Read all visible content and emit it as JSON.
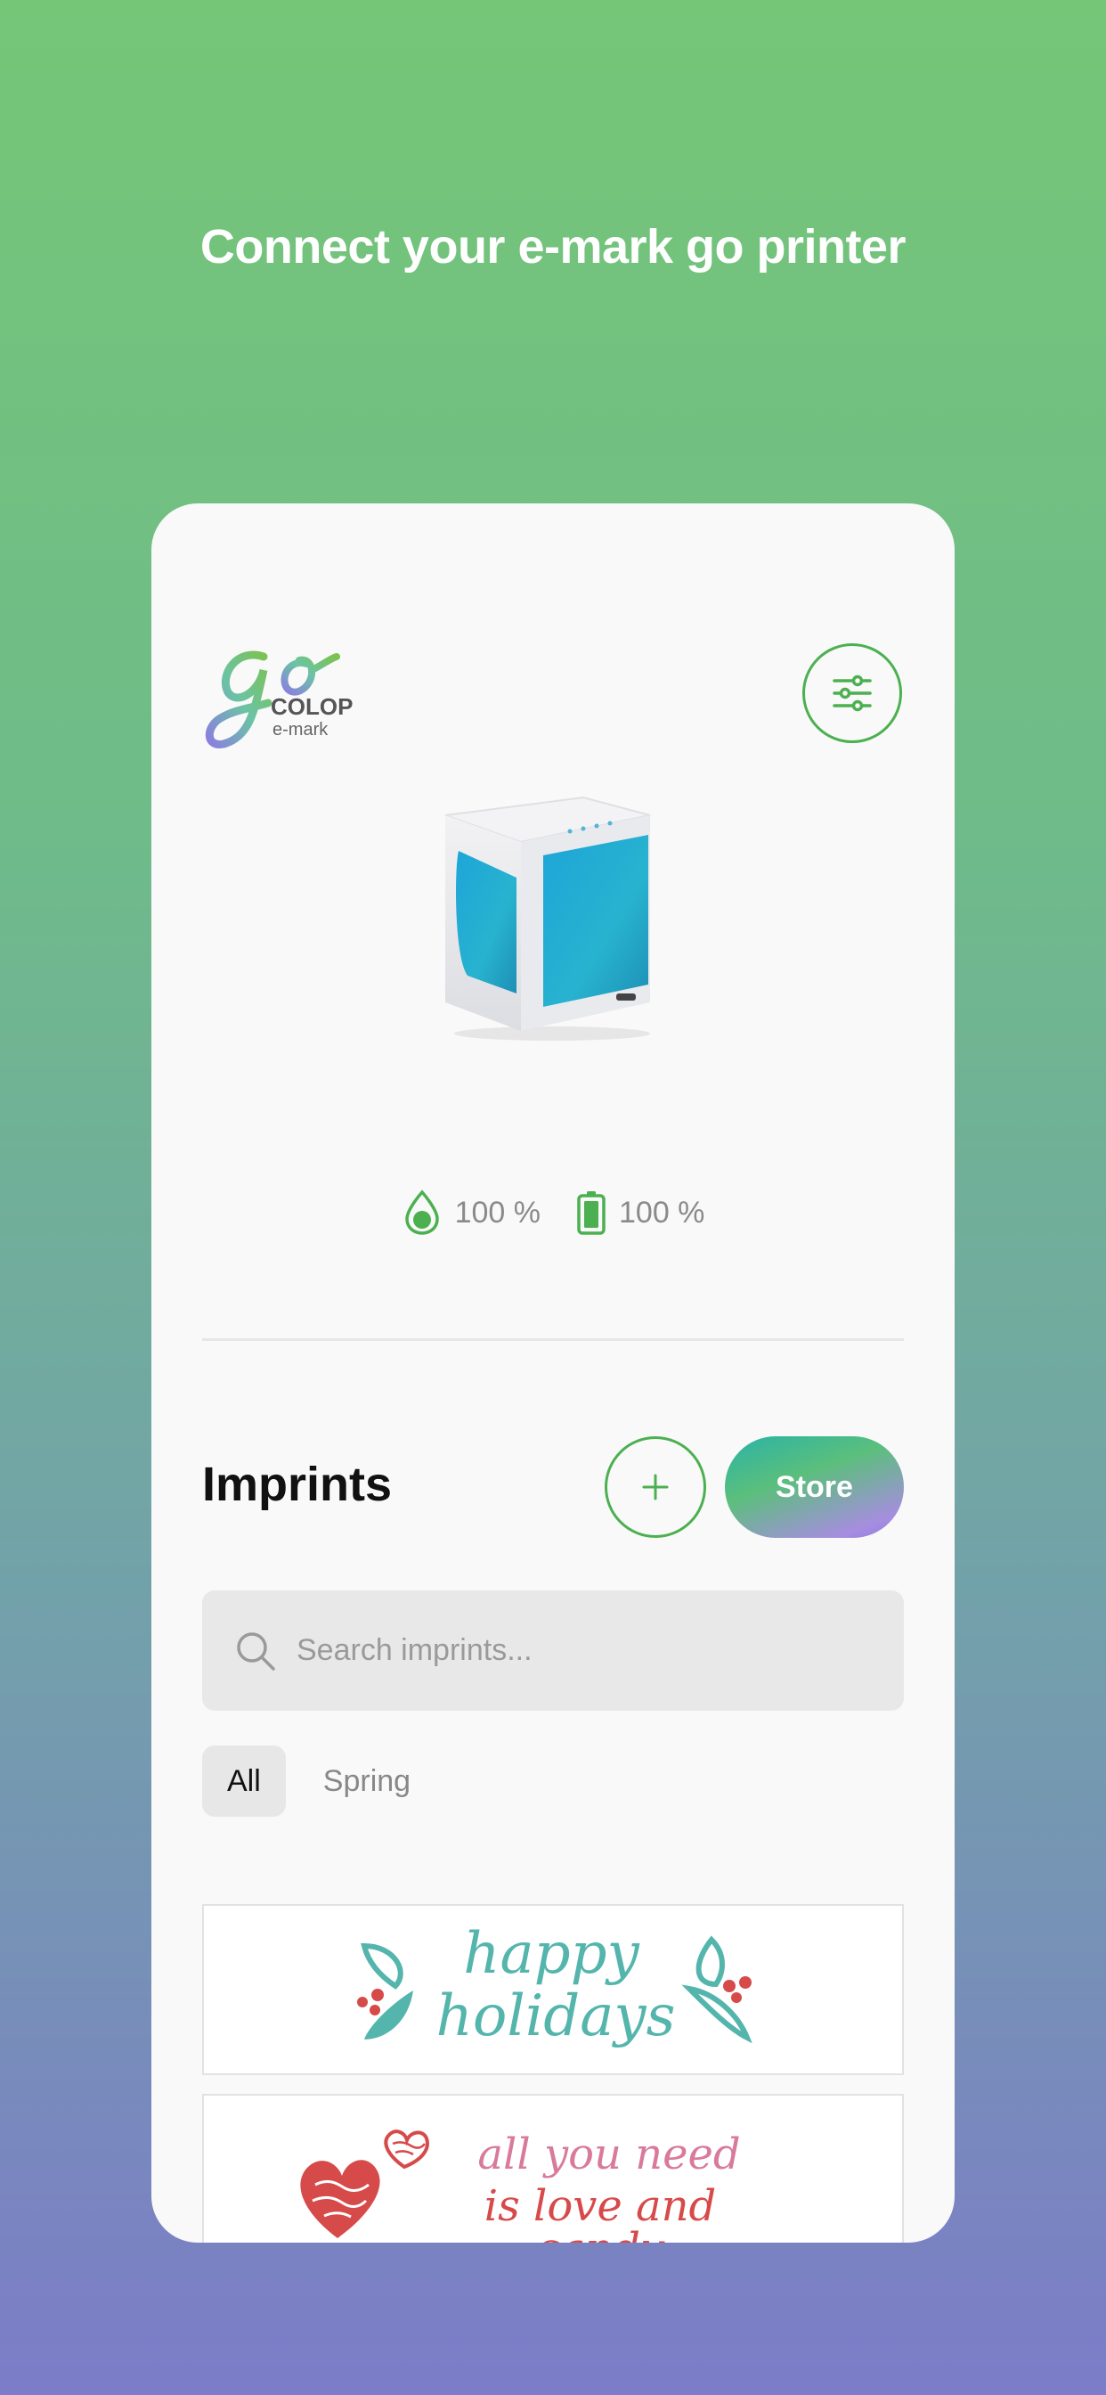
{
  "header": {
    "title": "Connect your e-mark go printer"
  },
  "logo": {
    "wordmark": "go",
    "brand": "COLOP",
    "sub": "e-mark"
  },
  "status": {
    "ink_label": "100 %",
    "battery_label": "100 %",
    "ink_level": 1.0,
    "battery_level": 1.0
  },
  "imprints": {
    "title": "Imprints",
    "add_icon": "plus-icon",
    "store_label": "Store",
    "search_placeholder": "Search imprints...",
    "filters": [
      {
        "label": "All",
        "active": true
      },
      {
        "label": "Spring",
        "active": false
      }
    ],
    "items": [
      {
        "line1": "happy",
        "line2": "holidays"
      },
      {
        "line1": "all you need",
        "line2": "is love and candy"
      }
    ]
  },
  "colors": {
    "accent": "#4cb050",
    "card": "#f9f9f9",
    "teal_text": "#54b5ac",
    "pink_text": "#d97a9c",
    "red_text": "#d74a4a"
  }
}
